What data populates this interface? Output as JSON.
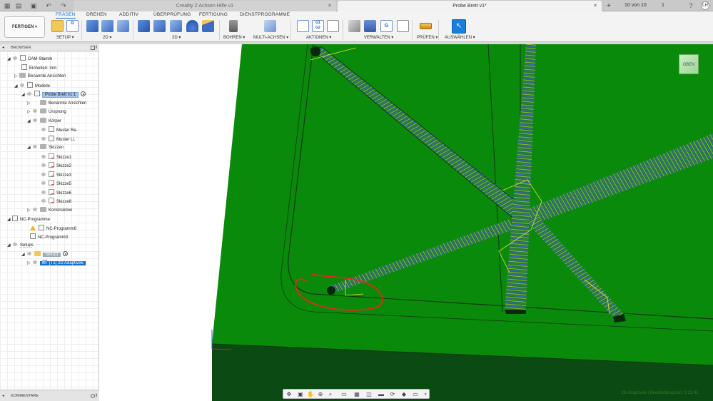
{
  "tabs": {
    "inactive_title": "Creality Z Achsen Hilfe v1",
    "active_title": "Probe Brett v1*",
    "job_status": "10 von 10",
    "notifications": "1",
    "user_initials": "LH"
  },
  "ribbon": {
    "workspace": "FERTIGEN ▾",
    "tabs": [
      {
        "label": "FRÄSEN"
      },
      {
        "label": "DREHEN"
      },
      {
        "label": "ADDITIV"
      },
      {
        "label": "ÜBERPRÜFUNG"
      },
      {
        "label": "FERTIGUNG"
      },
      {
        "label": "DIENSTPROGRAMME"
      }
    ],
    "groups": {
      "setup": "SETUP ▾",
      "d2": "2D ▾",
      "d3": "3D ▾",
      "bohren": "BOHREN ▾",
      "multiachsen": "MULTI-ACHSEN ▾",
      "aktionen": "AKTIONEN ▾",
      "verwalten": "VERWALTEN ▾",
      "pruefen": "PRÜFEN ▾",
      "auswaehlen": "AUSWÄHLEN ▾"
    },
    "icon_labels": {
      "g1g2": "G1\nG2"
    }
  },
  "browser": {
    "title": "BROWSER",
    "rows": [
      {
        "label": "CAM-Stamm"
      },
      {
        "label": "Einheiten: mm"
      },
      {
        "label": "Benannte Ansichten"
      },
      {
        "label": "Modelle"
      },
      {
        "label": "Probe Brett v1:1"
      },
      {
        "label": "Benannte Ansichten"
      },
      {
        "label": "Ursprung"
      },
      {
        "label": "Körper"
      },
      {
        "label": "Muster Re."
      },
      {
        "label": "Muster Li."
      },
      {
        "label": "Skizzen"
      },
      {
        "label": "Skizze1"
      },
      {
        "label": "Skizze2"
      },
      {
        "label": "Skizze3"
      },
      {
        "label": "Skizze5"
      },
      {
        "label": "Skizze6"
      },
      {
        "label": "Skizze8"
      },
      {
        "label": "Konstruktion"
      },
      {
        "label": "NC-Programme"
      },
      {
        "label": "NC-Programm6"
      },
      {
        "label": "NC-Programm9"
      },
      {
        "label": "Setups"
      },
      {
        "label": "Setup1"
      },
      {
        "label": "[T1] 2D Adaptive6"
      }
    ]
  },
  "comments": {
    "title": "KOMMENTARE"
  },
  "viewport": {
    "viewcube_label": "OBEN",
    "status": "2D Adaptive6 | Bearbeitungszeit: 0:23:41"
  },
  "colors": {
    "material_green": "#0a8a0a",
    "toolpath_blue": "#2d5fd1",
    "toolpath_yellow": "#e8e63a",
    "annotation_red": "#e22a18",
    "highlight_blue": "#1670d3"
  }
}
